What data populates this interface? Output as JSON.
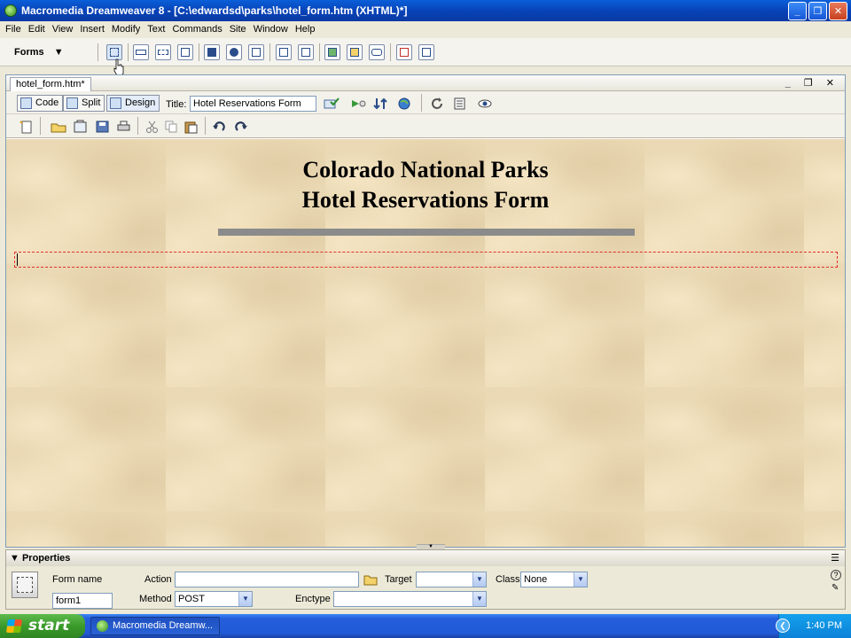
{
  "window": {
    "title": "Macromedia Dreamweaver 8 - [C:\\edwardsd\\parks\\hotel_form.htm (XHTML)*]",
    "controls": {
      "minimize": "_",
      "maximize": "❐",
      "close": "✕"
    }
  },
  "menubar": {
    "items": [
      "File",
      "Edit",
      "View",
      "Insert",
      "Modify",
      "Text",
      "Commands",
      "Site",
      "Window",
      "Help"
    ]
  },
  "insert_bar": {
    "category": "Forms",
    "tools": [
      "form-icon",
      "text-field-icon",
      "hidden-field-icon",
      "textarea-icon",
      "checkbox-icon",
      "radio-button-icon",
      "radio-group-icon",
      "list-menu-icon",
      "jump-menu-icon",
      "image-field-icon",
      "file-field-icon",
      "button-icon",
      "label-icon",
      "fieldset-icon"
    ]
  },
  "document": {
    "tab_label": "hotel_form.htm*",
    "view_buttons": {
      "code": "Code",
      "split": "Split",
      "design": "Design"
    },
    "title_label": "Title:",
    "title_value": "Hotel Reservations Form",
    "heading_line1": "Colorado National Parks",
    "heading_line2": "Hotel Reservations Form",
    "colors": {
      "rule": "#8b8b8b",
      "form_outline": "#e03030",
      "background": "#ead9b4"
    }
  },
  "properties": {
    "header": "Properties",
    "form_name_label": "Form name",
    "form_name_value": "form1",
    "action_label": "Action",
    "action_value": "",
    "target_label": "Target",
    "target_value": "",
    "class_label": "Class",
    "class_value": "None",
    "method_label": "Method",
    "method_value": "POST",
    "enctype_label": "Enctype",
    "enctype_value": ""
  },
  "taskbar": {
    "start_label": "start",
    "task_item": "Macromedia Dreamw...",
    "clock": "1:40 PM"
  }
}
